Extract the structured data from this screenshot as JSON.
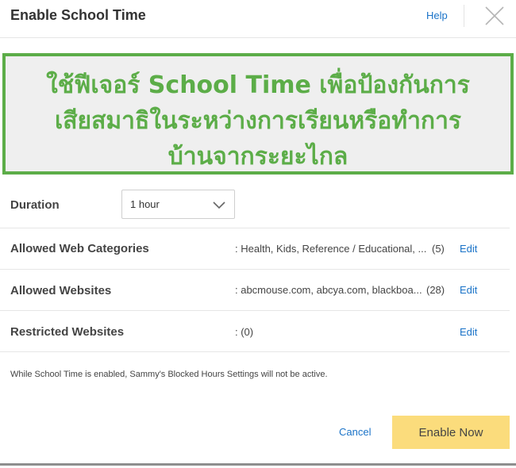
{
  "dialog": {
    "title": "Enable School Time",
    "help_label": "Help"
  },
  "banner": {
    "lines": [
      "ใช้ฟีเจอร์ School Time เพื่อป้องกันการ",
      "เสียสมาธิในระหว่างการเรียนหรือทำการ",
      "บ้านจากระยะไกล"
    ],
    "color": "#5cad48"
  },
  "settings": {
    "duration": {
      "label": "Duration",
      "selected": "1 hour"
    },
    "web_categories": {
      "label": "Allowed Web Categories",
      "value": ": Health, Kids, Reference / Educational, ...",
      "count": "(5)",
      "edit_label": "Edit"
    },
    "websites": {
      "label": "Allowed Websites",
      "value": ": abcmouse.com, abcya.com, blackboa...",
      "count": "(28)",
      "edit_label": "Edit"
    },
    "restricted": {
      "label": "Restricted Websites",
      "value": ": (0)",
      "edit_label": "Edit"
    }
  },
  "note": "While School Time is enabled, Sammy's Blocked Hours Settings will not be active.",
  "footer": {
    "cancel_label": "Cancel",
    "enable_label": "Enable Now",
    "enable_color": "#fbdc7c"
  },
  "icons": {
    "close": "close-icon",
    "dropdown": "chevron-down-icon"
  }
}
